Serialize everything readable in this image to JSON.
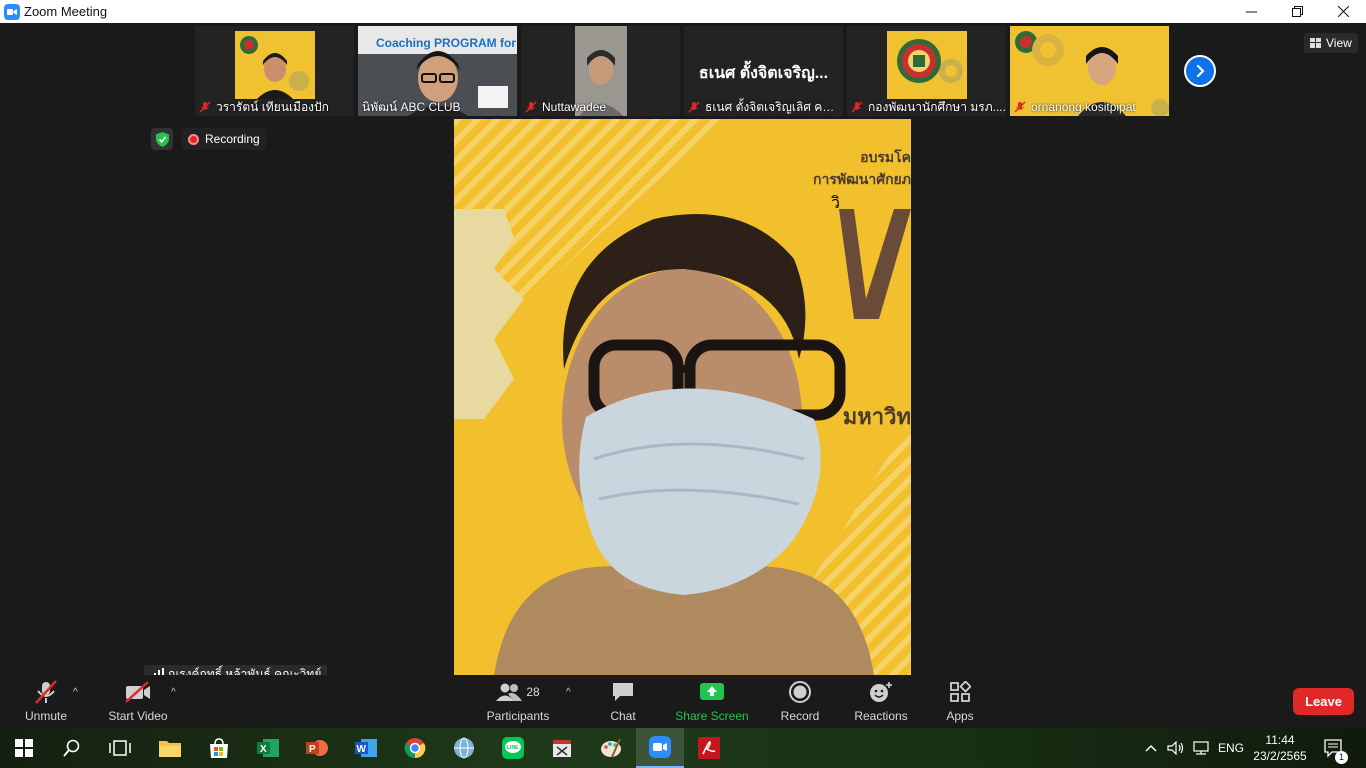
{
  "window": {
    "title": "Zoom Meeting",
    "minimize": "—",
    "maximize": "❐",
    "close": "✕"
  },
  "thumbnails": [
    {
      "name": "วรารัตน์ เทียนเมืองปัก",
      "muted": true
    },
    {
      "name": "นิพัฒน์ ABC CLUB",
      "muted": false,
      "overlay_text": "Coaching PROGRAM for ...er"
    },
    {
      "name": "Nuttawadee",
      "muted": true
    },
    {
      "name": "ธเนศ ตั้งจิตเจริญเลิศ คณะ...",
      "muted": true,
      "video_off_name": "ธเนศ ตั้งจิตเจริญ..."
    },
    {
      "name": "กองพัฒนานักศึกษา มรภ....",
      "muted": true
    },
    {
      "name": "ornanong kositpipat",
      "muted": true
    }
  ],
  "view_button": {
    "label": "View"
  },
  "recording": {
    "label": "Recording"
  },
  "main_video": {
    "banner_line1": "อบรมโค",
    "banner_line2": "การพัฒนาศักยภ",
    "banner_big": "วิ",
    "banner_line3": "มหาวิท"
  },
  "active_speaker": {
    "name": "ณรงค์ฤทธิ์ หล้าพันธ์ คณะวิทย์"
  },
  "toolbar": {
    "unmute": "Unmute",
    "start_video": "Start Video",
    "participants": "Participants",
    "participants_count": "28",
    "chat": "Chat",
    "share_screen": "Share Screen",
    "record": "Record",
    "reactions": "Reactions",
    "apps": "Apps",
    "leave": "Leave"
  },
  "taskbar": {
    "language": "ENG",
    "time": "11:44",
    "date": "23/2/2565",
    "notification_count": "1"
  },
  "colors": {
    "zoom_blue": "#2d8cff",
    "share_green": "#23c552",
    "leave_red": "#e02828",
    "background": "#1a1a1a"
  }
}
